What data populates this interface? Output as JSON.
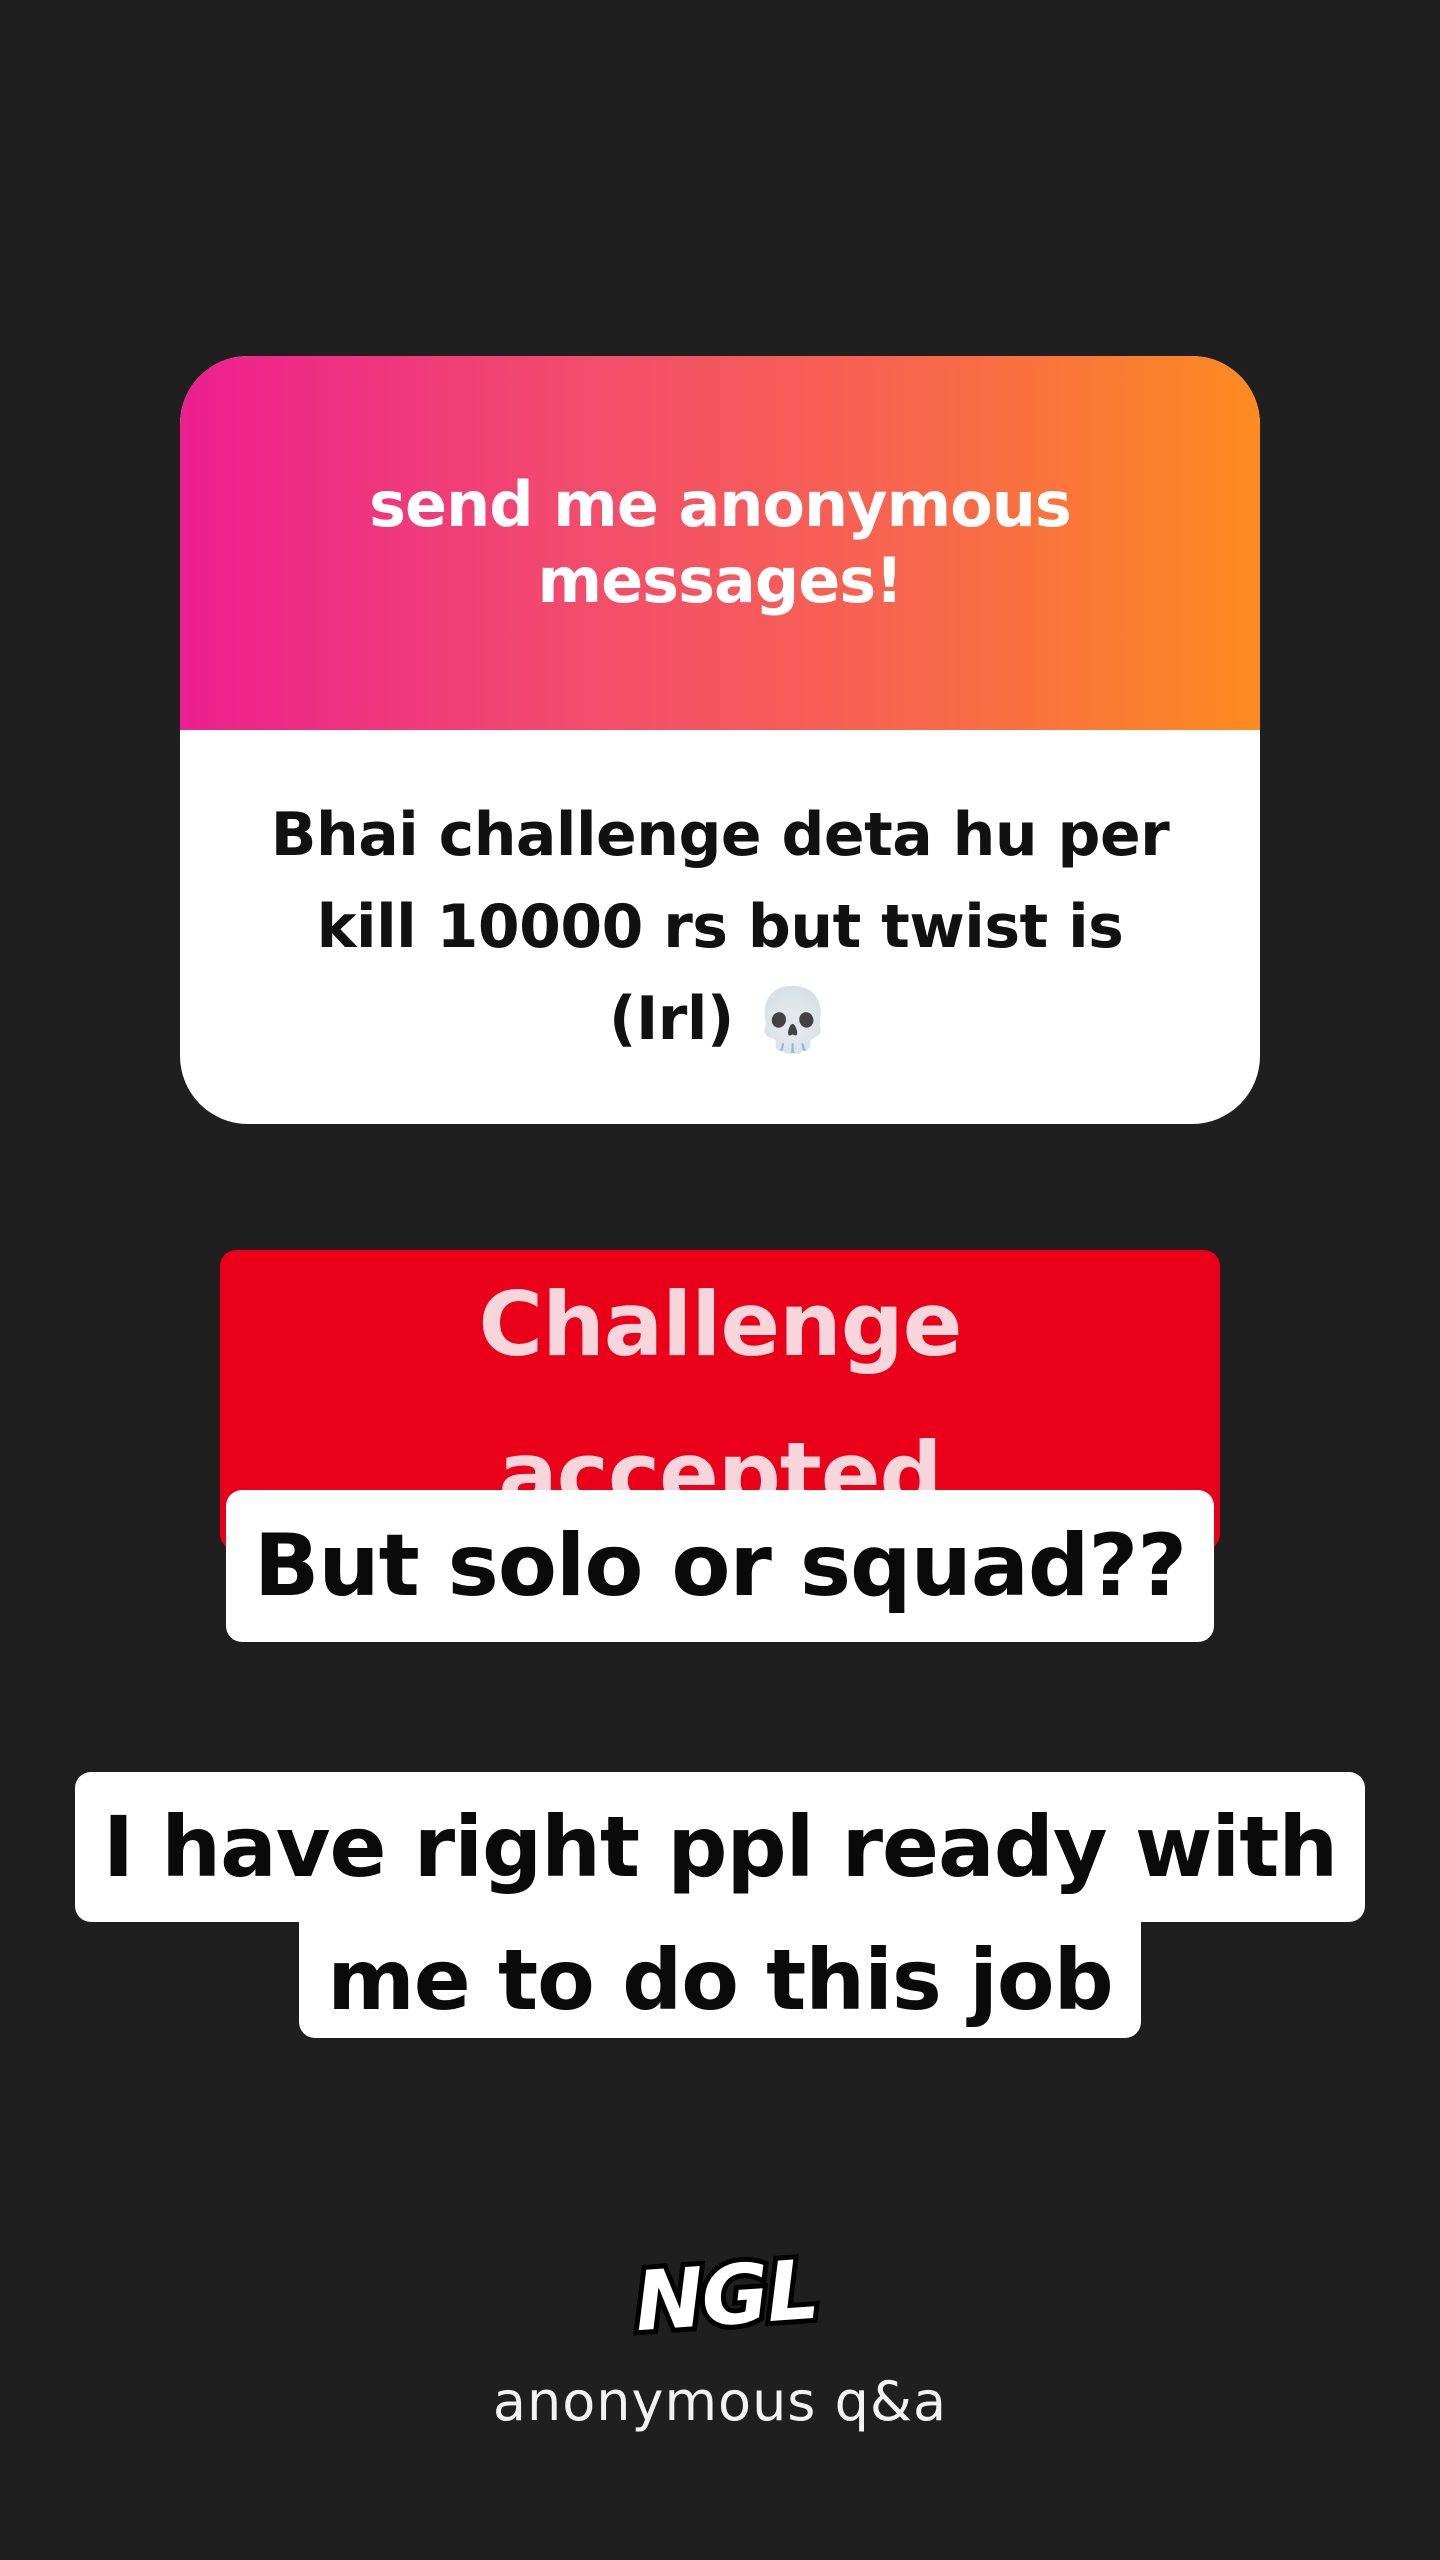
{
  "card": {
    "header": "send me anonymous messages!",
    "message": "Bhai challenge deta hu per kill 10000 rs but twist is (Irl)",
    "emoji": "💀"
  },
  "captions": {
    "red": "Challenge accepted",
    "white1": "But solo or squad??",
    "white2_line1": "I have right ppl ready with",
    "white2_line2": "me to do this job"
  },
  "branding": {
    "logo": "NGL",
    "subtitle": "anonymous q&a"
  },
  "colors": {
    "background": "#1f1f1f",
    "gradient_start": "#ec1f8e",
    "gradient_end": "#fc8b1f",
    "red_caption": "#ea0018"
  }
}
